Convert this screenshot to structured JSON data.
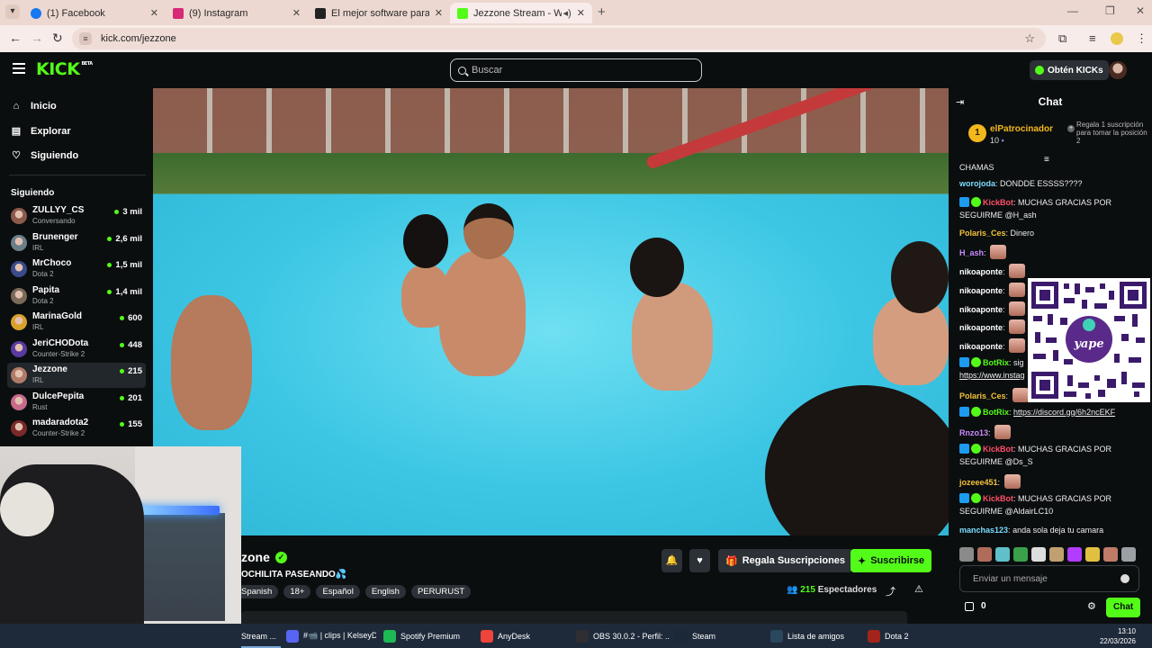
{
  "browser": {
    "tabs": [
      {
        "title": "(1) Facebook",
        "color": "#1877f2"
      },
      {
        "title": "(9) Instagram",
        "color": "#d62976"
      },
      {
        "title": "El mejor software para potencia",
        "color": "#222222"
      },
      {
        "title": "Jezzone Stream - Watch Liv",
        "color": "#53fc18"
      }
    ],
    "url": "kick.com/jezzone"
  },
  "header": {
    "logo": "KICK",
    "logo_badge": "BETA",
    "search_placeholder": "Buscar",
    "kicks_button": "Obtén KICKs"
  },
  "sidebar": {
    "nav": [
      {
        "label": "Inicio",
        "icon": "home-icon"
      },
      {
        "label": "Explorar",
        "icon": "browse-icon"
      },
      {
        "label": "Siguiendo",
        "icon": "heart-icon"
      }
    ],
    "following_heading": "Siguiendo",
    "channels": [
      {
        "name": "ZULLYY_CS",
        "category": "Conversando",
        "viewers": "3 mil",
        "color": "#8a5a4a"
      },
      {
        "name": "Brunenger",
        "category": "IRL",
        "viewers": "2,6 mil",
        "color": "#6a7f8a"
      },
      {
        "name": "MrChoco",
        "category": "Dota 2",
        "viewers": "1,5 mil",
        "color": "#3b4a8a"
      },
      {
        "name": "Papita",
        "category": "Dota 2",
        "viewers": "1,4 mil",
        "color": "#7a6a5a"
      },
      {
        "name": "MarinaGold",
        "category": "IRL",
        "viewers": "600",
        "color": "#d9a02a"
      },
      {
        "name": "JeriCHODota",
        "category": "Counter-Strike 2",
        "viewers": "448",
        "color": "#5a3aa0"
      },
      {
        "name": "Jezzone",
        "category": "IRL",
        "viewers": "215",
        "color": "#b07a68",
        "selected": true
      },
      {
        "name": "DulcePepita",
        "category": "Rust",
        "viewers": "201",
        "color": "#c86a8a"
      },
      {
        "name": "madaradota2",
        "category": "Counter-Strike 2",
        "viewers": "155",
        "color": "#7a2a2a"
      }
    ]
  },
  "stream": {
    "streamer": "zone",
    "title": "OCHILITA PASEANDO",
    "title_emoji": "💦",
    "tags": [
      "Spanish",
      "18+",
      "Español",
      "English",
      "PERURUST"
    ],
    "gift_button": "Regala Suscripciones",
    "subscribe_button": "Suscribirse",
    "viewers_count": "215",
    "viewers_label": "Espectadores"
  },
  "chat": {
    "title": "Chat",
    "pinned": {
      "rank": "1",
      "name": "elPatrocinador",
      "count": "10",
      "gift_text": "Regala 1 suscripción para tomar la posición 2"
    },
    "messages": [
      {
        "user": "",
        "text": "CHAMAS"
      },
      {
        "user": "worojoda",
        "color": "#7bdcff",
        "text": "DONDDE ESSSS????"
      },
      {
        "user": "KickBot",
        "color": "#ff4f6a",
        "badges": true,
        "text": "MUCHAS GRACIAS POR SEGUIRME @H_ash"
      },
      {
        "user": "Polaris_Ces",
        "color": "#f3c23a",
        "text": "Dinero"
      },
      {
        "user": "H_ash",
        "color": "#c98bff",
        "emote": true,
        "text": ""
      },
      {
        "user": "nikoaponte",
        "color": "#ffffff",
        "emote": true,
        "text": ""
      },
      {
        "user": "nikoaponte",
        "color": "#ffffff",
        "emote": true,
        "text": ""
      },
      {
        "user": "nikoaponte",
        "color": "#ffffff",
        "emote": true,
        "text": ""
      },
      {
        "user": "nikoaponte",
        "color": "#ffffff",
        "emote": true,
        "text": ""
      },
      {
        "user": "nikoaponte",
        "color": "#ffffff",
        "emote": true,
        "text": ""
      },
      {
        "user": "BotRix",
        "color": "#53fc18",
        "badges": true,
        "text": "sig",
        "link": "https://www.instag"
      },
      {
        "user": "Polaris_Ces",
        "color": "#f3c23a",
        "emote": true,
        "text": ""
      },
      {
        "user": "BotRix",
        "color": "#53fc18",
        "badges": true,
        "text": "",
        "link": "https://discord.gg/6h2ncEKF"
      },
      {
        "user": "Rnzo13",
        "color": "#c98bff",
        "emote": true,
        "text": ""
      },
      {
        "user": "KickBot",
        "color": "#ff4f6a",
        "badges": true,
        "text": "MUCHAS GRACIAS POR SEGUIRME @Ds_S"
      },
      {
        "user": "jozeee451",
        "color": "#f3c23a",
        "emote": true,
        "text": ""
      },
      {
        "user": "KickBot",
        "color": "#ff4f6a",
        "badges": true,
        "text": "MUCHAS GRACIAS POR SEGUIRME @AldairLC10"
      },
      {
        "user": "manchas123",
        "color": "#7bdcff",
        "text": "anda sola deja tu camara"
      }
    ],
    "qr_label": "yape",
    "input_placeholder": "Enviar un mensaje",
    "points": "0",
    "send_button": "Chat"
  },
  "taskbar": {
    "items": [
      {
        "label": "Stream ...",
        "color": "#4a6a8a"
      },
      {
        "label": "#📹 | clips | KelseyD...",
        "color": "#5865f2"
      },
      {
        "label": "Spotify Premium",
        "color": "#1db954"
      },
      {
        "label": "AnyDesk",
        "color": "#ef443b"
      },
      {
        "label": "OBS 30.0.2 - Perfil: ...",
        "color": "#302e31"
      },
      {
        "label": "Steam",
        "color": "#1b2838"
      },
      {
        "label": "Lista de amigos",
        "color": "#2a475e"
      },
      {
        "label": "Dota 2",
        "color": "#a3241a"
      }
    ],
    "time": "13:10",
    "date": "22/03/2026"
  }
}
